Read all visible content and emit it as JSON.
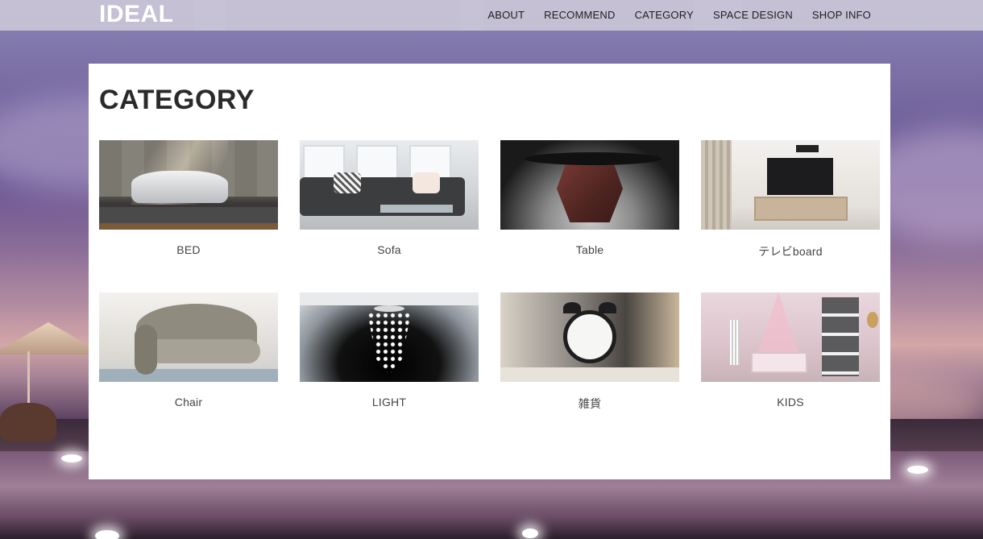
{
  "header": {
    "logo": "IDEAL",
    "nav": [
      {
        "label": "ABOUT"
      },
      {
        "label": "RECOMMEND"
      },
      {
        "label": "CATEGORY"
      },
      {
        "label": "SPACE DESIGN"
      },
      {
        "label": "SHOP INFO"
      }
    ]
  },
  "main": {
    "title": "CATEGORY",
    "categories": [
      {
        "label": "BED",
        "image": "bed-photo"
      },
      {
        "label": "Sofa",
        "image": "sofa-photo"
      },
      {
        "label": "Table",
        "image": "table-photo"
      },
      {
        "label": "テレビboard",
        "image": "tv-board-photo"
      },
      {
        "label": "Chair",
        "image": "chair-photo"
      },
      {
        "label": "LIGHT",
        "image": "chandelier-photo"
      },
      {
        "label": "雑貨",
        "image": "alarm-clock-photo"
      },
      {
        "label": "KIDS",
        "image": "kids-room-photo"
      }
    ]
  },
  "colors": {
    "card_background": "#ffffff",
    "nav_bar": "#d6d2de",
    "logo": "#ffffff",
    "heading": "#2a2a2a"
  }
}
